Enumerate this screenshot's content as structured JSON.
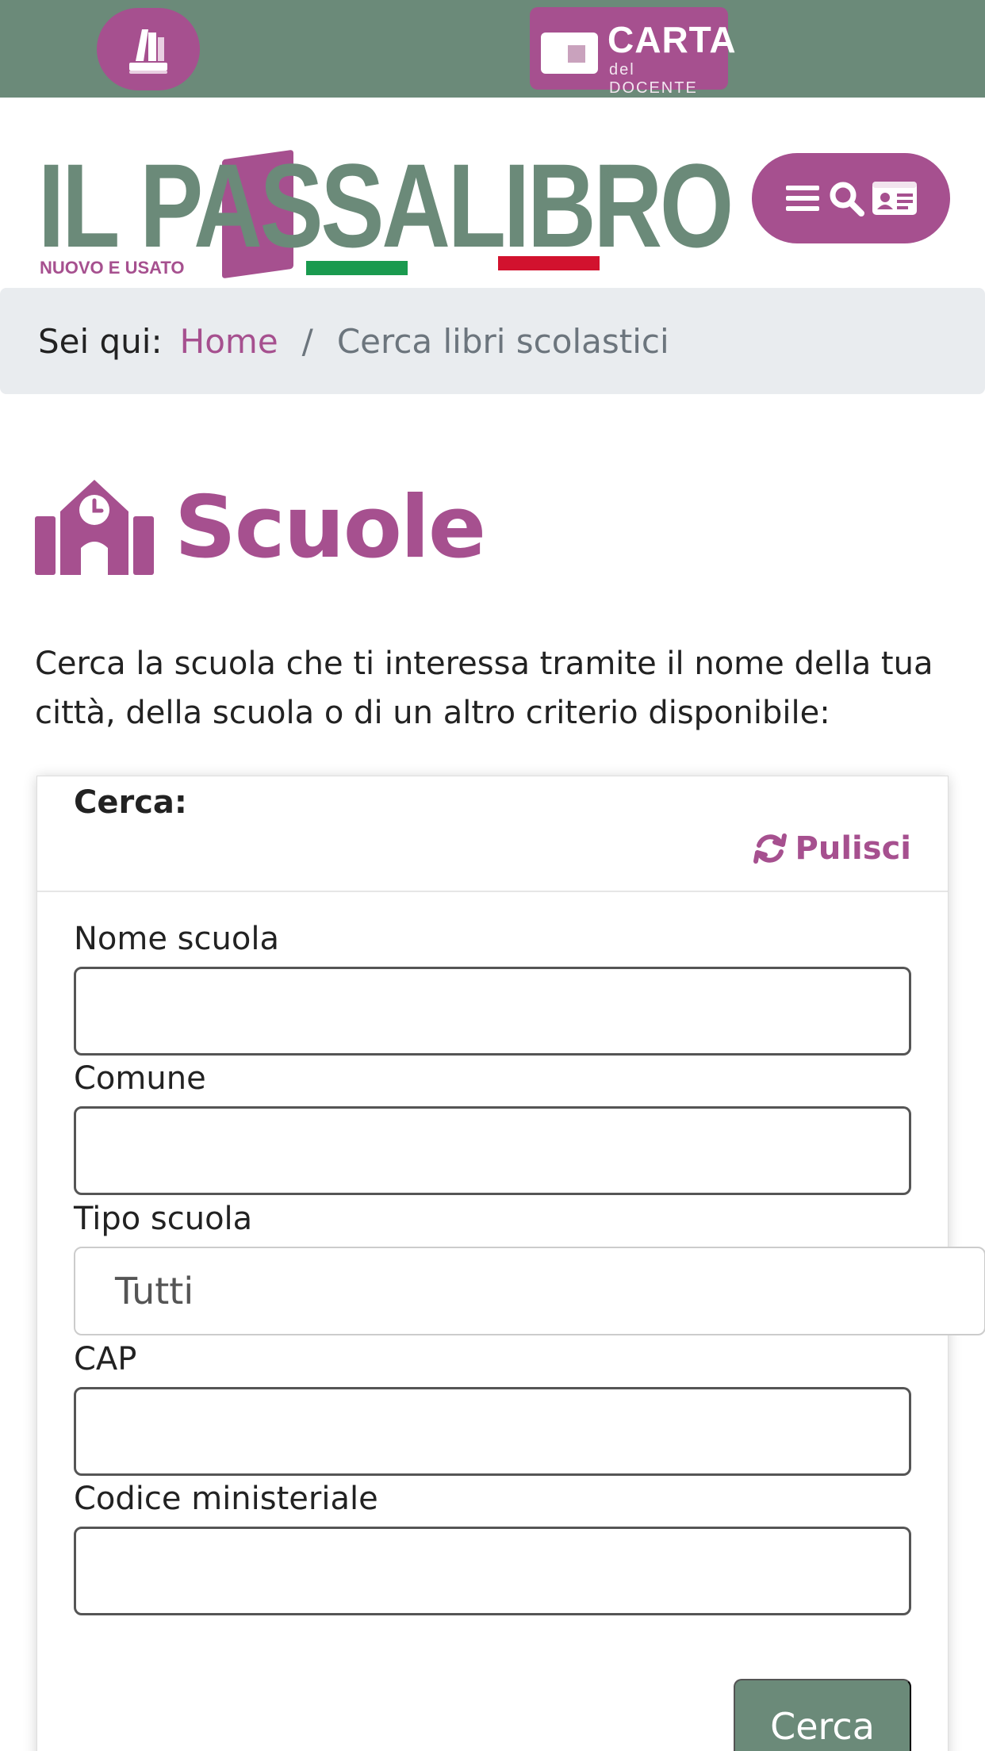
{
  "topbar": {
    "carta_title": "CARTA",
    "carta_sub": "del DOCENTE",
    "bg_color": "#6b8a79",
    "accent_color": "#a6508f"
  },
  "header": {
    "logo_text": "IL PASSALIBRO",
    "logo_tagline": "NUOVO E USATO",
    "logo_registered": "®",
    "menu_icons": [
      "menu-icon",
      "search-icon",
      "id-card-icon"
    ]
  },
  "breadcrumb": {
    "label": "Sei qui:",
    "home": "Home",
    "separator": "/",
    "current": "Cerca libri scolastici"
  },
  "page": {
    "title": "Scuole",
    "title_icon": "school-icon",
    "intro": "Cerca la scuola che ti interessa tramite il nome della tua città, della scuola o di un altro criterio disponibile:"
  },
  "form": {
    "heading": "Cerca:",
    "clear_label": "Pulisci",
    "fields": [
      {
        "label": "Nome scuola",
        "value": "",
        "placeholder": ""
      },
      {
        "label": "Comune",
        "value": "",
        "placeholder": ""
      },
      {
        "label": "Tipo scuola",
        "value": "Tutti"
      },
      {
        "label": "CAP",
        "value": "",
        "placeholder": ""
      },
      {
        "label": "Codice ministeriale",
        "value": "",
        "placeholder": ""
      }
    ],
    "submit_label": "Cerca"
  }
}
